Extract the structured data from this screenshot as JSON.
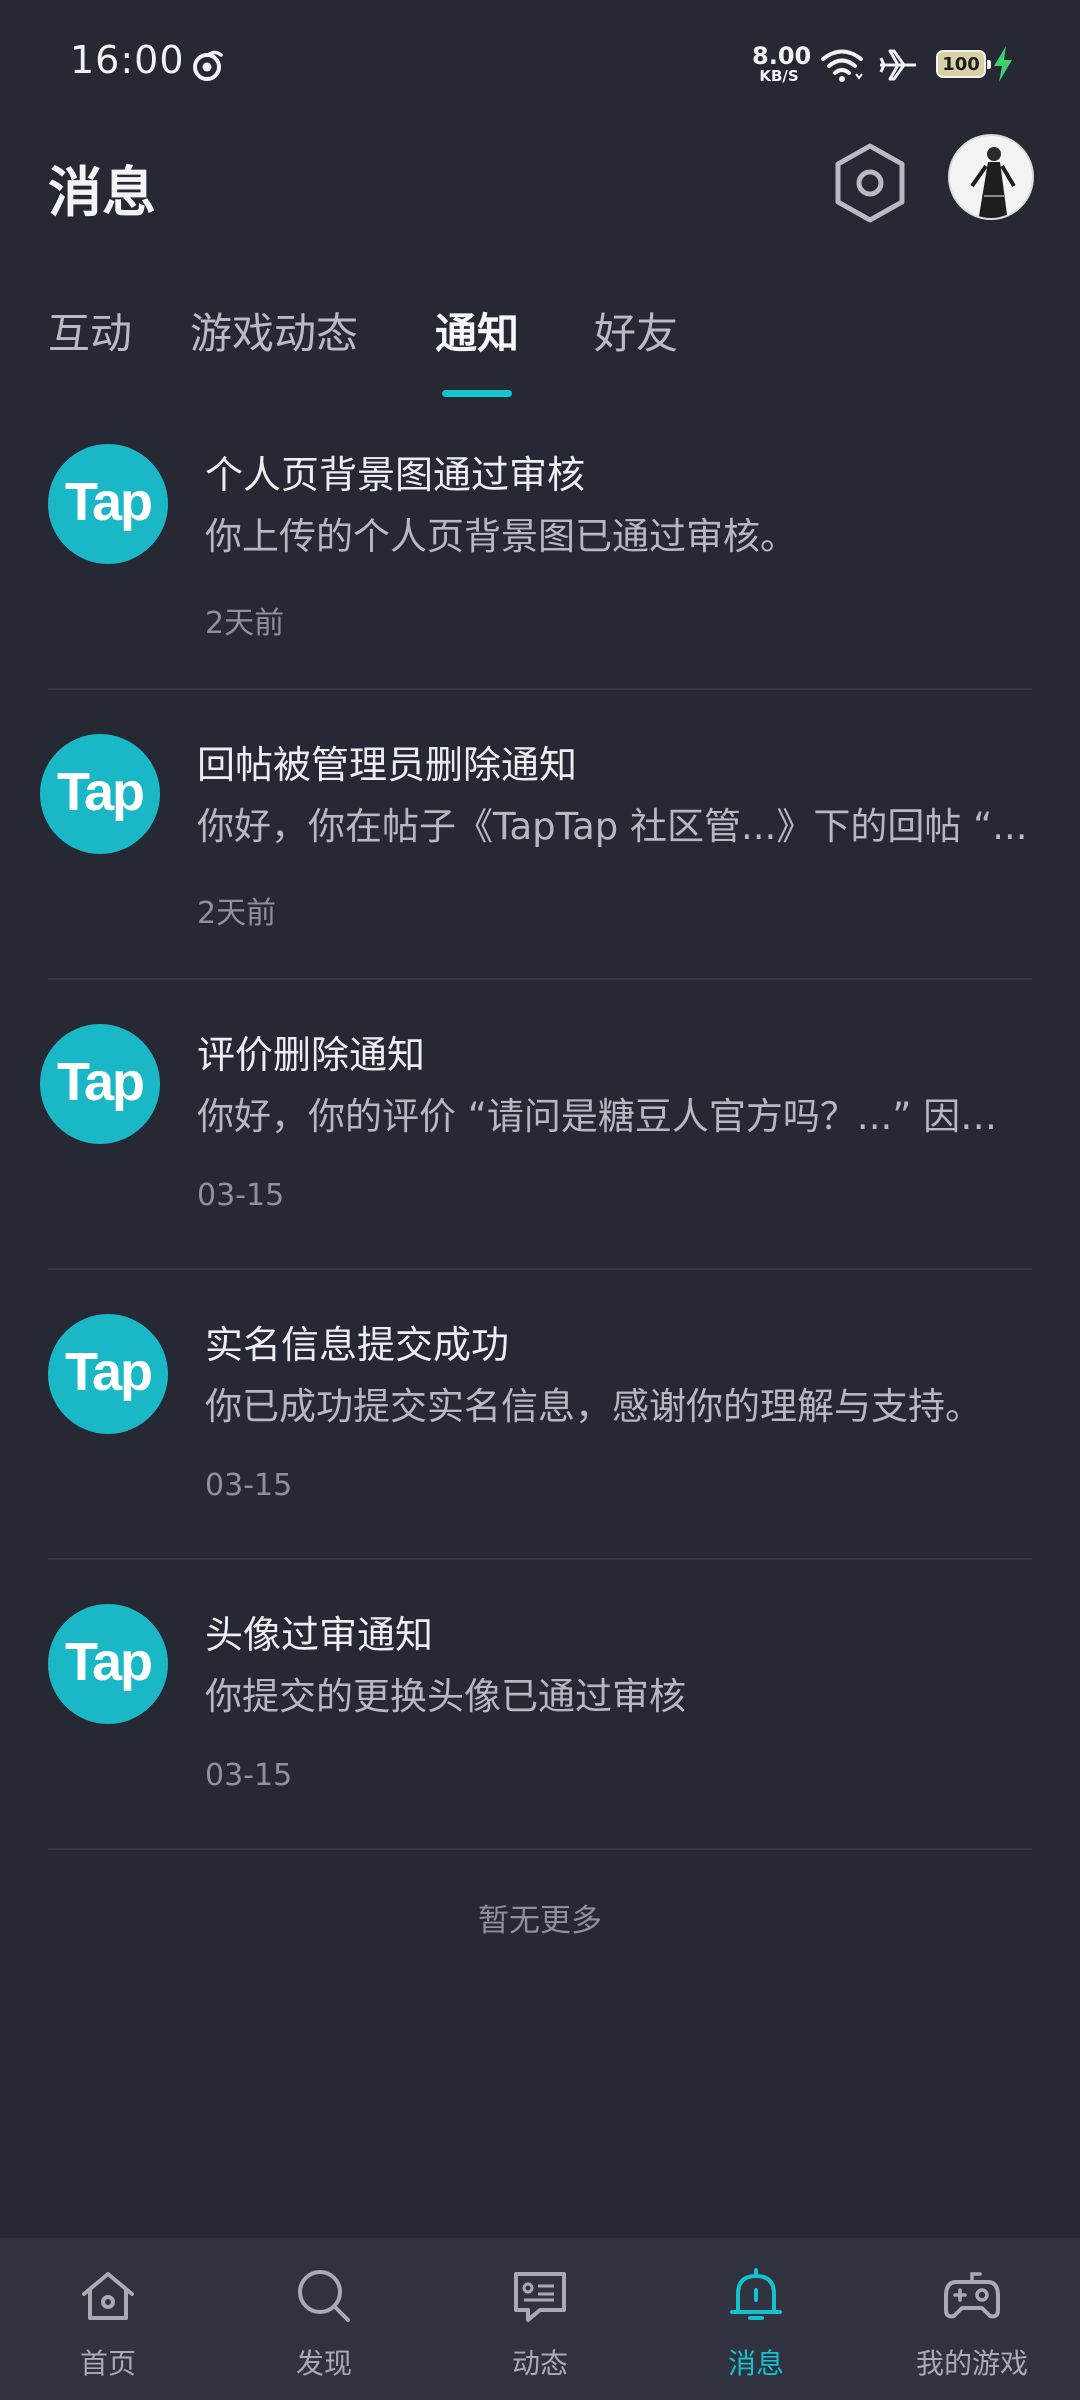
{
  "status_bar": {
    "time": "16:00",
    "net_speed_value": "8.00",
    "net_speed_unit": "KB/S",
    "battery_level": "100",
    "icons": [
      "weibo-icon",
      "wifi-icon",
      "airplane-mode-icon",
      "battery-icon",
      "charging-icon"
    ]
  },
  "header": {
    "title": "消息",
    "settings_icon": "hexagon-settings-icon",
    "avatar_icon": "user-avatar"
  },
  "tabs": [
    {
      "label": "互动",
      "active": false
    },
    {
      "label": "游戏动态",
      "active": false
    },
    {
      "label": "通知",
      "active": true
    },
    {
      "label": "好友",
      "active": false
    }
  ],
  "notifications": [
    {
      "logo": "Tap",
      "title": "个人页背景图通过审核",
      "body": "你上传的个人页背景图已通过审核。",
      "time": "2天前"
    },
    {
      "logo": "Tap",
      "title": "回帖被管理员删除通知",
      "body": "你好，你在帖子《TapTap 社区管...》下的回帖 “...",
      "time": "2天前"
    },
    {
      "logo": "Tap",
      "title": "评价删除通知",
      "body": "你好，你的评价 “请问是糖豆人官方吗？...” 因违...",
      "time": "03-15"
    },
    {
      "logo": "Tap",
      "title": "实名信息提交成功",
      "body": "你已成功提交实名信息，感谢你的理解与支持。",
      "time": "03-15"
    },
    {
      "logo": "Tap",
      "title": "头像过审通知",
      "body": "你提交的更换头像已通过审核",
      "time": "03-15"
    }
  ],
  "footer_text": "暂无更多",
  "bottom_nav": [
    {
      "label": "首页",
      "icon": "home-icon",
      "active": false
    },
    {
      "label": "发现",
      "icon": "search-icon",
      "active": false
    },
    {
      "label": "动态",
      "icon": "chat-card-icon",
      "active": false
    },
    {
      "label": "消息",
      "icon": "bell-icon",
      "active": true
    },
    {
      "label": "我的游戏",
      "icon": "gamepad-icon",
      "active": false
    }
  ],
  "colors": {
    "background": "#262833",
    "accent": "#15c5ce",
    "tap_logo": "#1ab8c6",
    "nav_background": "#30323f"
  }
}
